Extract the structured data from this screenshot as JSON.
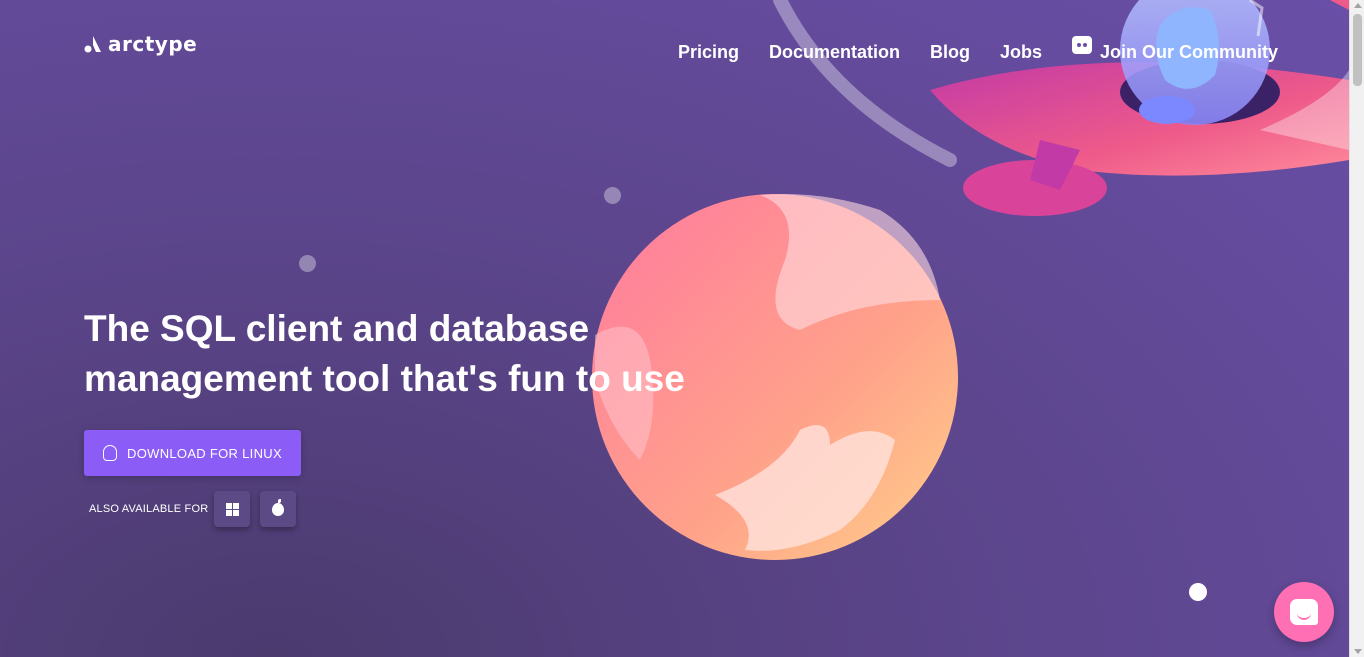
{
  "brand": {
    "name": "arctype"
  },
  "nav": {
    "items": [
      {
        "label": "Pricing"
      },
      {
        "label": "Documentation"
      },
      {
        "label": "Blog"
      },
      {
        "label": "Jobs"
      }
    ],
    "community_label": "Join Our Community"
  },
  "hero": {
    "title_line1": "The SQL client and database",
    "title_line2": "management tool that's fun to use",
    "download_label": "DOWNLOAD FOR LINUX",
    "also_available": "ALSO AVAILABLE FOR"
  },
  "icons": {
    "logo": "arctype-logo-icon",
    "linux": "linux-icon",
    "windows": "windows-icon",
    "apple": "apple-icon",
    "discord": "discord-icon",
    "chat": "chat-icon"
  },
  "colors": {
    "accent": "#8b5cf6",
    "background": "#5a4488",
    "chat": "#ff6fb3"
  }
}
